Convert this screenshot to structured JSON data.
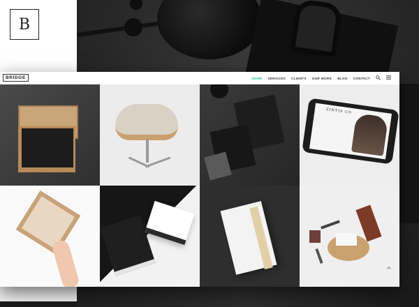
{
  "logo": {
    "letter": "B"
  },
  "site": {
    "brand": "BRIDGE",
    "nav": [
      {
        "label": "HOME",
        "active": true
      },
      {
        "label": "SERVICES",
        "active": false
      },
      {
        "label": "CLIENTS",
        "active": false
      },
      {
        "label": "OUR WORK",
        "active": false
      },
      {
        "label": "BLOG",
        "active": false
      },
      {
        "label": "CONTACT",
        "active": false
      }
    ],
    "icons": {
      "search": "search-icon",
      "menu": "menu-icon",
      "back_to_top": "arrow-up-icon"
    },
    "accent_color": "#1abc9c",
    "portfolio": [
      {
        "subject": "business card box"
      },
      {
        "subject": "armchair"
      },
      {
        "subject": "desk stationery"
      },
      {
        "subject": "phone magazine",
        "screen_text": "ZINTIS CO"
      },
      {
        "subject": "hand holding box"
      },
      {
        "subject": "black and white books"
      },
      {
        "subject": "open book"
      },
      {
        "subject": "grooming set"
      }
    ]
  }
}
